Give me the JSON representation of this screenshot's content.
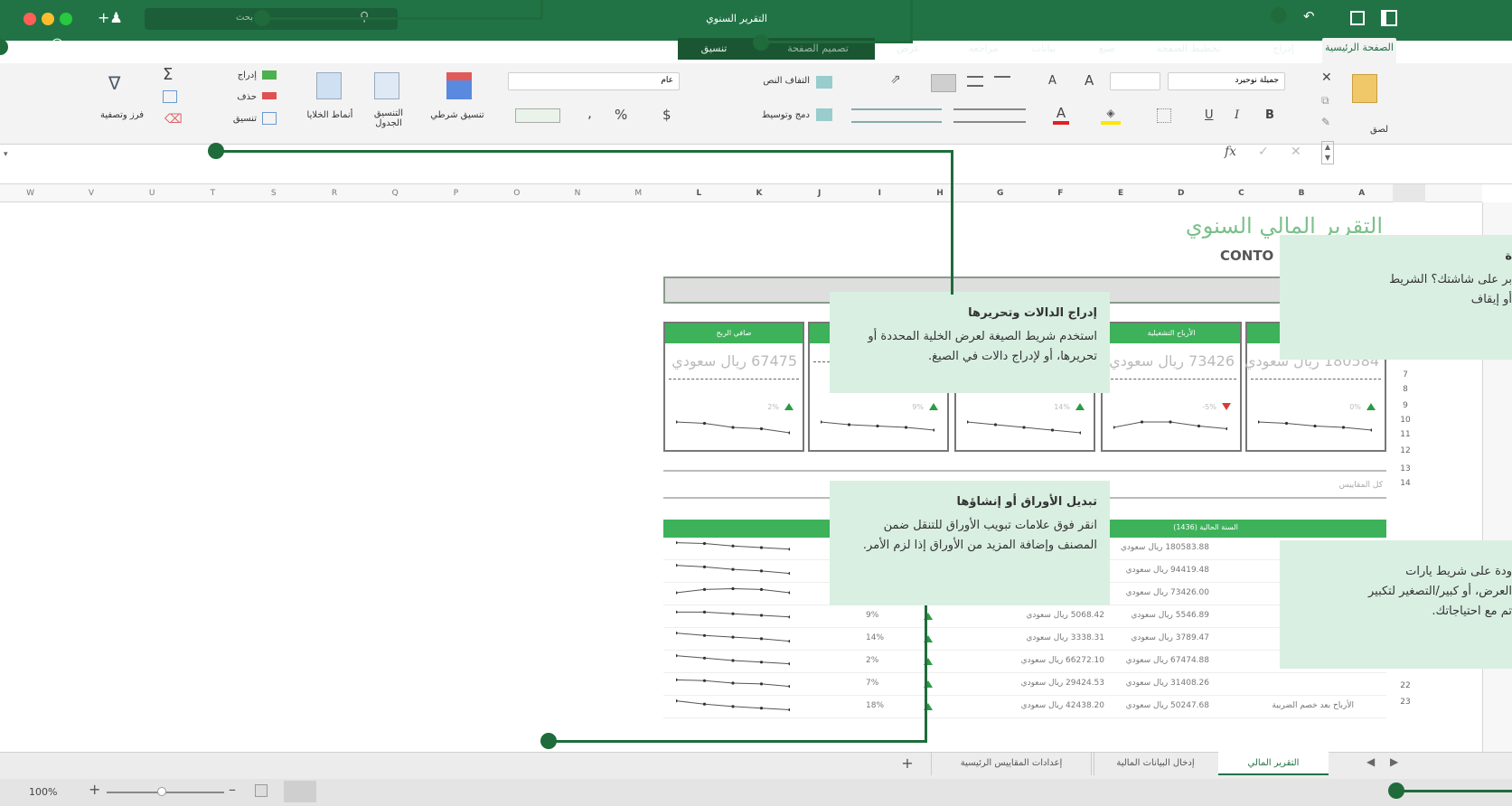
{
  "window": {
    "title": "التقرير السنوي"
  },
  "search": {
    "placeholder": "بحث"
  },
  "tabs": [
    "الصفحة الرئيسية",
    "إدراج",
    "تخطيط الصفحة",
    "صيغ",
    "بيانات",
    "مراجعة",
    "عرض",
    "تصميم الصفحة",
    "تنسيق"
  ],
  "ribbon": {
    "paste": "لصق",
    "font_name": "جميلة نوحيرد",
    "bold": "B",
    "italic": "I",
    "underline": "U",
    "font_color_letter": "A",
    "grow_font": "A",
    "shrink_font": "A",
    "wrap_text": "التفاف النص",
    "merge_center": "دمج وتوسيط",
    "number_format": "عام",
    "currency": "$",
    "percent": "%",
    "comma": "‚",
    "conditional_format": "تنسيق شرطي",
    "format_as_table": "التنسيق الجدول",
    "cell_styles": "أنماط الخلايا",
    "insert": "إدراج",
    "delete": "حذف",
    "format": "تنسيق",
    "autosum": "Σ",
    "sort_filter": "فرز وتصفية"
  },
  "formula_bar": {
    "fx": "fx"
  },
  "columns_left": [
    "W",
    "V",
    "U",
    "T",
    "S",
    "R",
    "Q",
    "P",
    "O",
    "N",
    "M"
  ],
  "columns_right": [
    "L",
    "K",
    "J",
    "I",
    "H",
    "G",
    "F",
    "E",
    "D",
    "C",
    "B",
    "A"
  ],
  "rows": [
    "7",
    "8",
    "9",
    "10",
    "11",
    "12",
    "13",
    "14",
    "",
    "",
    "",
    "",
    "22",
    "23"
  ],
  "sheet": {
    "title": "التقرير المالي السنوي",
    "company": "CONTO",
    "cards": [
      {
        "header": "صافي الربح",
        "value": "67475 ريال سعودي",
        "pct": "2%",
        "dir": "up"
      },
      {
        "header": "",
        "value": "",
        "pct": "9%",
        "dir": "up"
      },
      {
        "header": "",
        "value": "",
        "pct": "14%",
        "dir": "up"
      },
      {
        "header": "الأرباح التشغيلية",
        "value": "73426 ريال سعودي",
        "pct": "-5%",
        "dir": "down"
      },
      {
        "header": "",
        "value": "180584 ريال سعودي",
        "pct": "0%",
        "dir": "up"
      }
    ],
    "table_header_year": "السنة الحالية (1436)",
    "measures_label": "كل المقاييس",
    "table_rows": [
      {
        "pct": "",
        "current": "180583.88 ريال سعودي",
        "prev": ""
      },
      {
        "pct": "",
        "current": "94419.48 ريال سعودي",
        "prev": ""
      },
      {
        "pct": "",
        "current": "73426.00 ريال سعودي",
        "prev": ""
      },
      {
        "pct": "9%",
        "current": "5546.89 ريال سعودي",
        "prev": "5068.42 ريال سعودي"
      },
      {
        "pct": "14%",
        "current": "3789.47 ريال سعودي",
        "prev": "3338.31 ريال سعودي"
      },
      {
        "pct": "2%",
        "current": "67474.88 ريال سعودي",
        "prev": "66272.10 ريال سعودي"
      },
      {
        "pct": "7%",
        "current": "31408.26 ريال سعودي",
        "prev": "29424.53 ريال سعودي"
      },
      {
        "pct": "18%",
        "current": "50247.68 ريال سعودي",
        "prev": "42438.20 ريال سعودي",
        "label": "الأرباح بعد خصم الضريبة"
      }
    ]
  },
  "sheet_tabs": [
    "التقرير المالي",
    "إدخال البيانات المالية",
    "إعدادات المقاييس الرئيسية"
  ],
  "status": {
    "zoom": "100%"
  },
  "callouts": {
    "formula": {
      "title": "إدراج الدالات وتحريرها",
      "body": "استخدم شريط الصيغة لعرض الخلية المحددة أو تحريرها، أو لإدراج دالات في الصيغ."
    },
    "sheets": {
      "title": "تبديل الأوراق أو إنشاؤها",
      "body": "انقر فوق علامات تبويب الأوراق للتنقل ضمن المصنف وإضافة المزيد من الأوراق إذا لزم الأمر."
    },
    "right_top": {
      "title": "ة",
      "body": "بر على شاشتك؟ الشريط أو إيقاف"
    },
    "right_bottom": {
      "title": "",
      "body": "ودة على شريط يارات العرض، أو كبير/التصغير لتكبير تم مع احتياجاتك."
    }
  }
}
